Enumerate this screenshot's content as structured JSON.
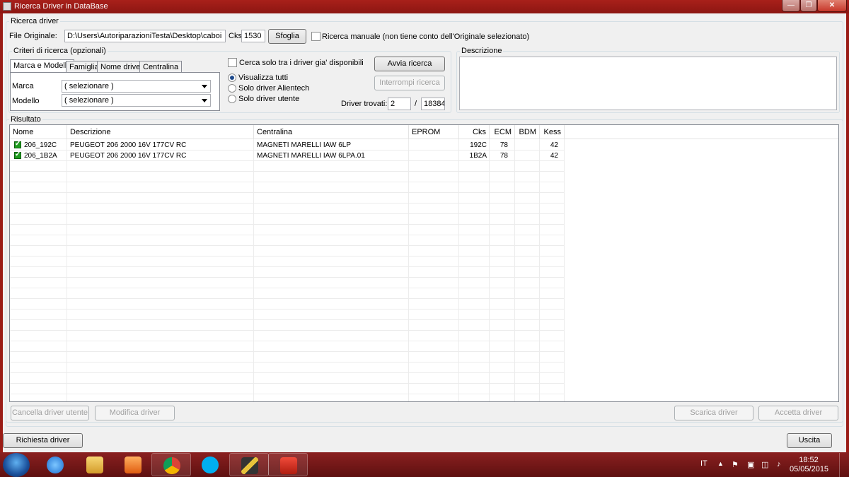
{
  "window": {
    "title": "Ricerca Driver in DataBase",
    "buttons": {
      "minimize": "—",
      "maximize": "❐",
      "close": "✕"
    }
  },
  "search_group": {
    "legend": "Ricerca driver",
    "file_label": "File Originale:",
    "file_value": "D:\\Users\\AutoriparazioniTesta\\Desktop\\caboi",
    "cks_label": "Cks",
    "cks_value": "1530",
    "browse_label": "Sfoglia",
    "manual_search_label": "Ricerca manuale (non tiene conto dell'Originale selezionato)"
  },
  "criteria_group": {
    "legend": "Criteri di ricerca (opzionali)",
    "tabs": [
      "Marca e Modello",
      "Famiglia",
      "Nome driver",
      "Centralina"
    ],
    "active_tab": 0,
    "brand_label": "Marca",
    "brand_value": "( selezionare )",
    "model_label": "Modello",
    "model_value": "( selezionare )",
    "only_available_label": "Cerca solo tra i driver gia' disponibili",
    "radio_options": [
      "Visualizza tutti",
      "Solo driver Alientech",
      "Solo driver utente"
    ],
    "radio_selected": 0,
    "start_search_label": "Avvia ricerca",
    "stop_search_label": "Interrompi ricerca",
    "found_label": "Driver trovati:",
    "found_value": "2",
    "separator": "/",
    "total_value": "18384"
  },
  "description_group": {
    "legend": "Descrizione"
  },
  "results_group": {
    "legend": "Risultato",
    "columns": [
      "Nome",
      "Descrizione",
      "Centralina",
      "EPROM",
      "Cks",
      "ECM",
      "BDM",
      "Kess"
    ],
    "rows": [
      {
        "checked": true,
        "nome": "206_192C",
        "descrizione": "PEUGEOT 206 2000 16V 177CV RC",
        "centralina": "MAGNETI MARELLI  IAW 6LP",
        "eprom": "",
        "cks": "192C",
        "ecm": "78",
        "bdm": "",
        "kess": "42"
      },
      {
        "checked": true,
        "nome": "206_1B2A",
        "descrizione": "PEUGEOT 206 2000 16V 177CV RC",
        "centralina": "MAGNETI MARELLI  IAW 6LPA.01",
        "eprom": "",
        "cks": "1B2A",
        "ecm": "78",
        "bdm": "",
        "kess": "42"
      }
    ]
  },
  "actions": {
    "delete_user_driver": "Cancella driver utente",
    "modify_driver": "Modifica driver",
    "download_driver": "Scarica driver",
    "accept_driver": "Accetta driver",
    "request_driver": "Richiesta driver",
    "exit": "Uscita"
  },
  "taskbar": {
    "language": "IT",
    "time": "18:52",
    "date": "05/05/2015"
  },
  "colors": {
    "titlebar": "#9a1c16",
    "taskbar": "#6e1414",
    "check_green": "#1e9b1e"
  }
}
